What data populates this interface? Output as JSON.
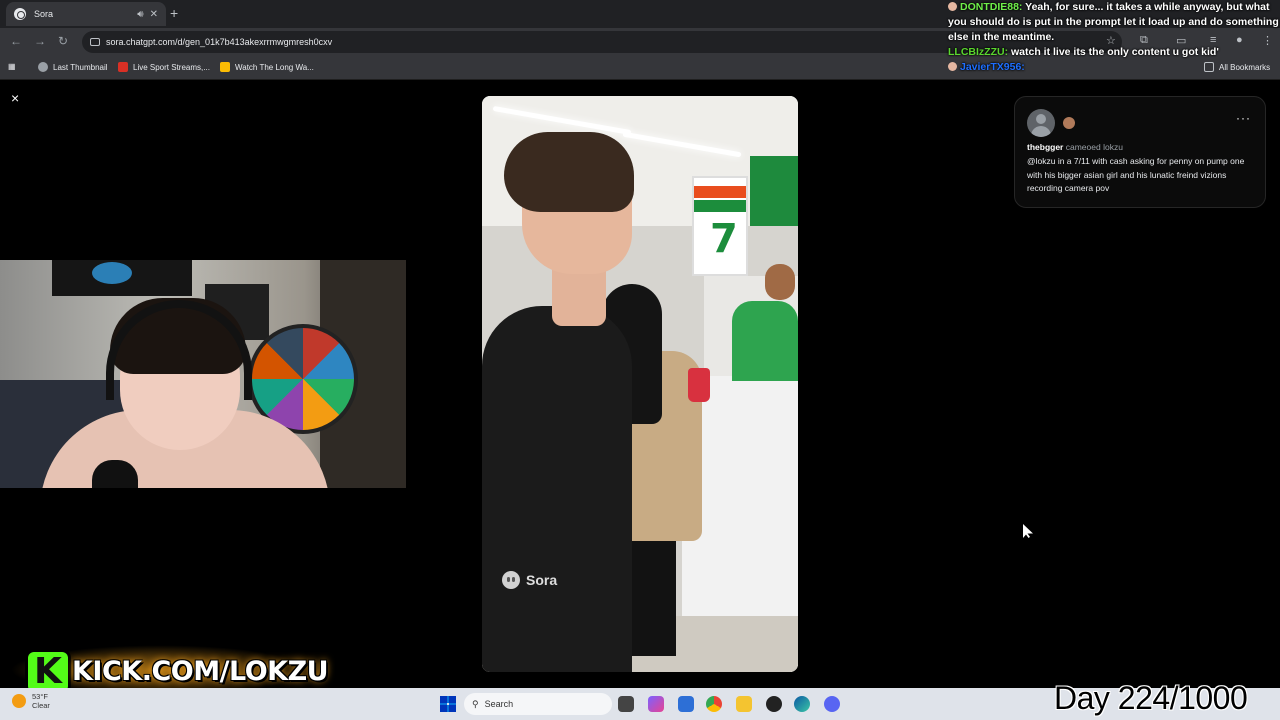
{
  "browser": {
    "tab": {
      "title": "Sora"
    },
    "new_tab_symbol": "+",
    "url": "sora.chatgpt.com/d/gen_01k7b413akexrrmwgmresh0cxv",
    "bookmarks": [
      {
        "label": "Last Thumbnail",
        "icon": "globe-icon"
      },
      {
        "label": "Live Sport Streams,...",
        "icon": "live-icon"
      },
      {
        "label": "Watch The Long Wa...",
        "icon": "hd-icon"
      }
    ],
    "all_bookmarks": "All Bookmarks"
  },
  "viewer": {
    "close_symbol": "×",
    "video_watermark": "Sora"
  },
  "info_card": {
    "username": "thebgger",
    "action": "cameoed lokzu",
    "more_symbol": "···",
    "prompt": "@lokzu in a 7/11 with cash asking for penny on pump one with his bigger asian girl and his lunatic freind vizions recording camera pov"
  },
  "chat": [
    {
      "user": "DONTDIE88:",
      "message": " Yeah, for sure... it takes a while anyway, but what you should do is put in the prompt let it load up and do something else in the meantime."
    },
    {
      "user": "LLCBIzZZU:",
      "message": " watch it live its the only content u got kid'"
    },
    {
      "user": "JavierTX956:",
      "message": ""
    }
  ],
  "stream_overlay": {
    "kick_letter": "K",
    "kick_url": "KICK.COM/LOKZU",
    "day_counter": "Day 224/1000"
  },
  "taskbar": {
    "weather_temp": "53°F",
    "weather_desc": "Clear",
    "search_placeholder": "Search"
  },
  "colors": {
    "kick_green": "#53fc18",
    "chat_user_green": "#6ff04a",
    "chat_user_blue": "#1e6fff"
  }
}
